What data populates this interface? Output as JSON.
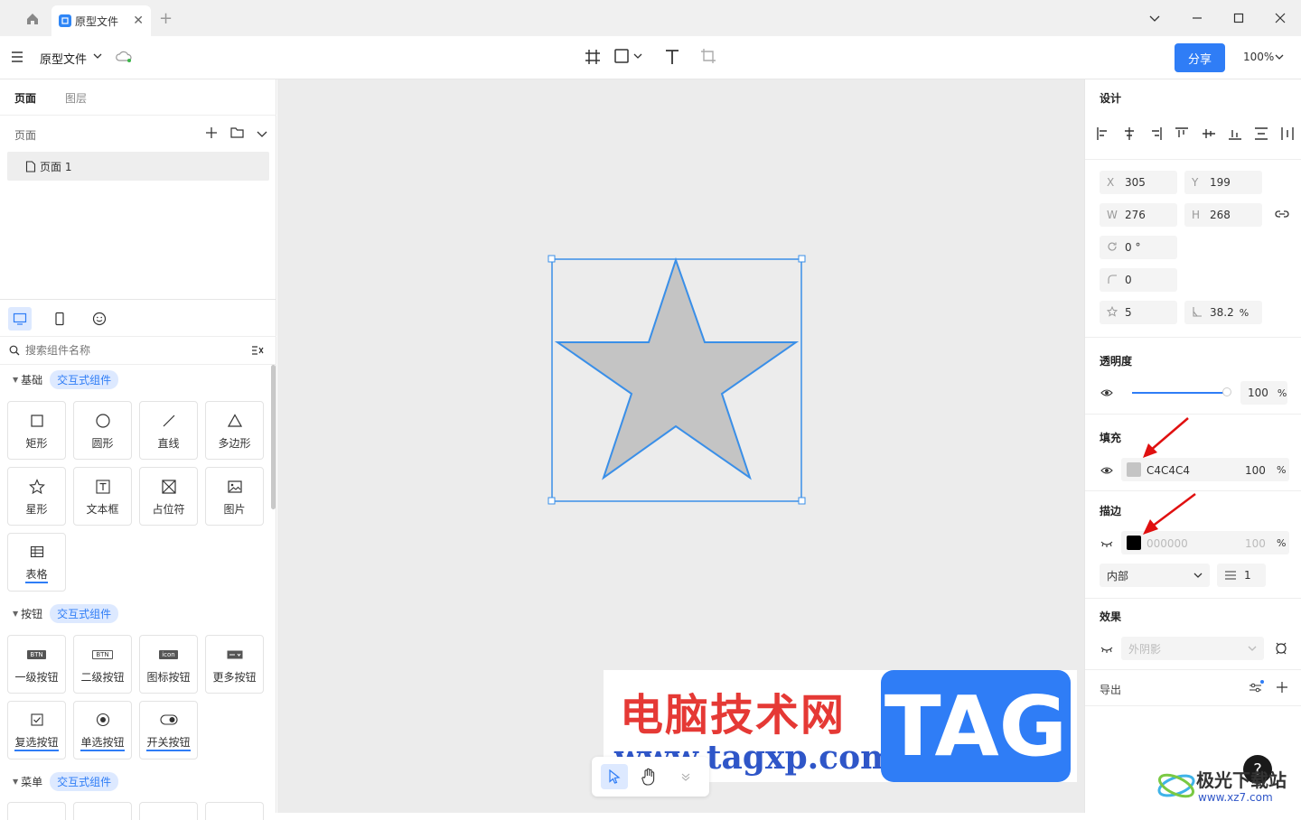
{
  "titlebar": {
    "tab_title": "原型文件",
    "close_glyph": "✕",
    "new_tab_glyph": "+"
  },
  "toolbar": {
    "file_title": "原型文件",
    "share_label": "分享",
    "zoom_label": "100%"
  },
  "left_panel": {
    "tabs": [
      "页面",
      "图层"
    ],
    "pages_header": "页面",
    "page_items": [
      "页面 1"
    ],
    "search_placeholder": "搜索组件名称",
    "categories": [
      {
        "label": "基础",
        "chip": "交互式组件",
        "items": [
          "矩形",
          "圆形",
          "直线",
          "多边形",
          "星形",
          "文本框",
          "占位符",
          "图片",
          "表格"
        ]
      },
      {
        "label": "按钮",
        "chip": "交互式组件",
        "items": [
          "一级按钮",
          "二级按钮",
          "图标按钮",
          "更多按钮",
          "复选按钮",
          "单选按钮",
          "开关按钮"
        ]
      },
      {
        "label": "菜单",
        "chip": "交互式组件"
      }
    ],
    "button_icon_texts": [
      "BTN",
      "BTN",
      "icon"
    ]
  },
  "right_panel": {
    "design_title": "设计",
    "x_label": "X",
    "x": "305",
    "y_label": "Y",
    "y": "199",
    "w_label": "W",
    "w": "276",
    "h_label": "H",
    "h": "268",
    "rotation": "0 °",
    "radius": "0",
    "points": "5",
    "ratio": "38.2",
    "pct": "%",
    "opacity_title": "透明度",
    "opacity_value": "100",
    "opacity_level": 1.0,
    "fill_title": "填充",
    "fill_hex": "C4C4C4",
    "fill_color": "#c4c4c4",
    "fill_opacity": "100",
    "stroke_title": "描边",
    "stroke_hex": "000000",
    "stroke_color": "#000000",
    "stroke_opacity": "100",
    "stroke_position": "内部",
    "stroke_width": "1",
    "effect_title": "效果",
    "effect_value": "外阴影",
    "export_title": "导出"
  },
  "watermark": {
    "cn": "电脑技术网",
    "url": "www.tagxp.com",
    "tag": "TAG",
    "brand": "极光下载站",
    "brand_url": "www.xz7.com"
  },
  "help_glyph": "?"
}
